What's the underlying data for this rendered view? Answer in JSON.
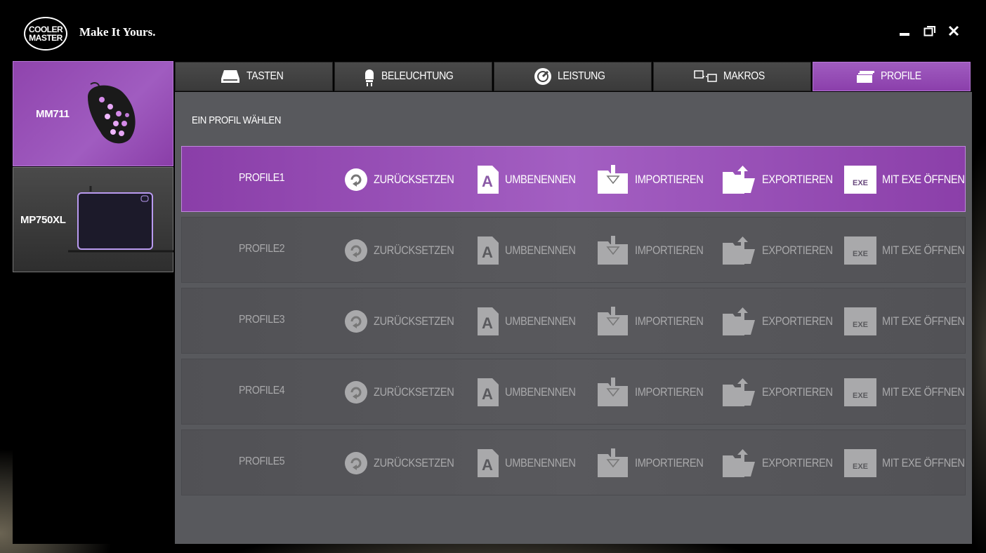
{
  "app": {
    "logo_line1": "COOLER",
    "logo_line2": "MASTER",
    "tagline": "Make It Yours."
  },
  "window_controls": [
    "minimize-icon",
    "restore-icon",
    "close-icon"
  ],
  "devices": [
    {
      "label": "MM711",
      "icon": "mouse-image",
      "selected": true
    },
    {
      "label": "MP750XL",
      "icon": "mousepad-image",
      "selected": false
    }
  ],
  "tabs": [
    {
      "label": "TASTEN",
      "icon": "keys-icon",
      "active": false
    },
    {
      "label": "BELEUCHTUNG",
      "icon": "lighting-icon",
      "active": false
    },
    {
      "label": "LEISTUNG",
      "icon": "performance-icon",
      "active": false
    },
    {
      "label": "MAKROS",
      "icon": "macro-icon",
      "active": false
    },
    {
      "label": "PROFILE",
      "icon": "profile-icon",
      "active": true
    }
  ],
  "section_title": "EIN PROFIL WÄHLEN",
  "actions": {
    "reset": "ZURÜCKSETZEN",
    "rename": "UMBENENNEN",
    "import": "IMPORTIEREN",
    "export": "EXPORTIEREN",
    "open_exe": "MIT EXE ÖFFNEN",
    "exe_badge": "EXE",
    "rename_glyph": "A"
  },
  "profiles": [
    {
      "name": "PROFILE1",
      "active": true
    },
    {
      "name": "PROFILE2",
      "active": false
    },
    {
      "name": "PROFILE3",
      "active": false
    },
    {
      "name": "PROFILE4",
      "active": false
    },
    {
      "name": "PROFILE5",
      "active": false
    }
  ],
  "colors": {
    "accent": "#9b51bd",
    "panel": "#58595d",
    "inactive_text": "#a9a9ab"
  }
}
